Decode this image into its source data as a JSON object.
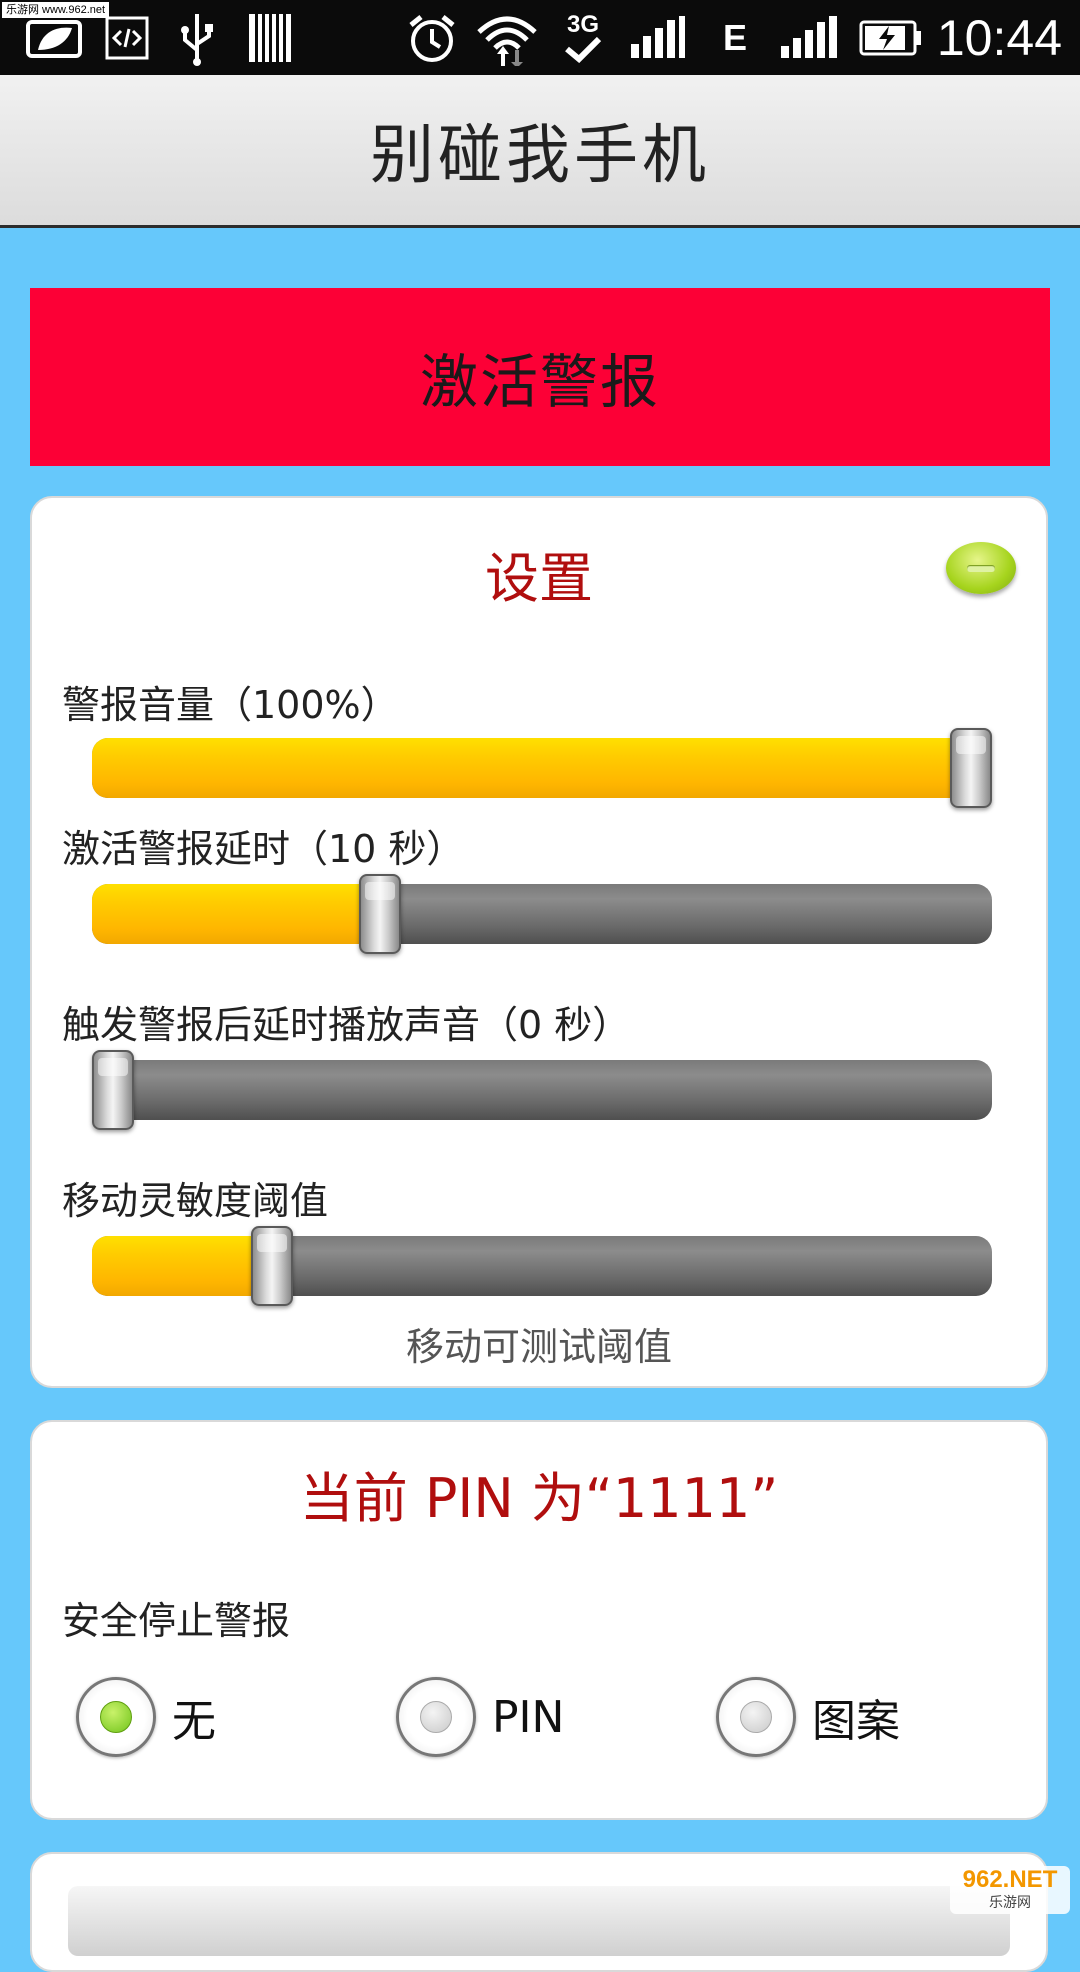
{
  "status_bar": {
    "watermark": "乐游网 www.962.net",
    "network_type_3g": "3G",
    "network_type_e": "E",
    "time": "10:44",
    "icons": [
      "leaf-notification-icon",
      "code-icon",
      "usb-icon",
      "barcode-icon",
      "alarm-icon",
      "wifi-icon",
      "3g-check-icon",
      "signal-icon",
      "e-signal-icon",
      "battery-charging-icon"
    ]
  },
  "app": {
    "title": "别碰我手机"
  },
  "activate_button": {
    "label": "激活警报",
    "color": "#fc0036"
  },
  "settings": {
    "title": "设置",
    "collapse_icon": "minus-icon",
    "sliders": [
      {
        "label": "警报音量（100%）",
        "value": 1.0
      },
      {
        "label": "激活警报延时（10 秒）",
        "value": 0.32
      },
      {
        "label": "触发警报后延时播放声音（0 秒）",
        "value": 0.0
      },
      {
        "label": "移动灵敏度阈值",
        "value": 0.2
      }
    ],
    "hint": "移动可测试阈值"
  },
  "pin": {
    "title": "当前 PIN 为“1111”",
    "stop_label": "安全停止警报",
    "options": [
      {
        "label": "无",
        "selected": true
      },
      {
        "label": "PIN",
        "selected": false
      },
      {
        "label": "图案",
        "selected": false
      }
    ]
  },
  "watermark_bottom": {
    "brand": "962.NET",
    "sub": "乐游网"
  },
  "colors": {
    "background": "#66c8fb",
    "accent_red": "#b00e0e",
    "slider_fill": "#ffcc00"
  }
}
